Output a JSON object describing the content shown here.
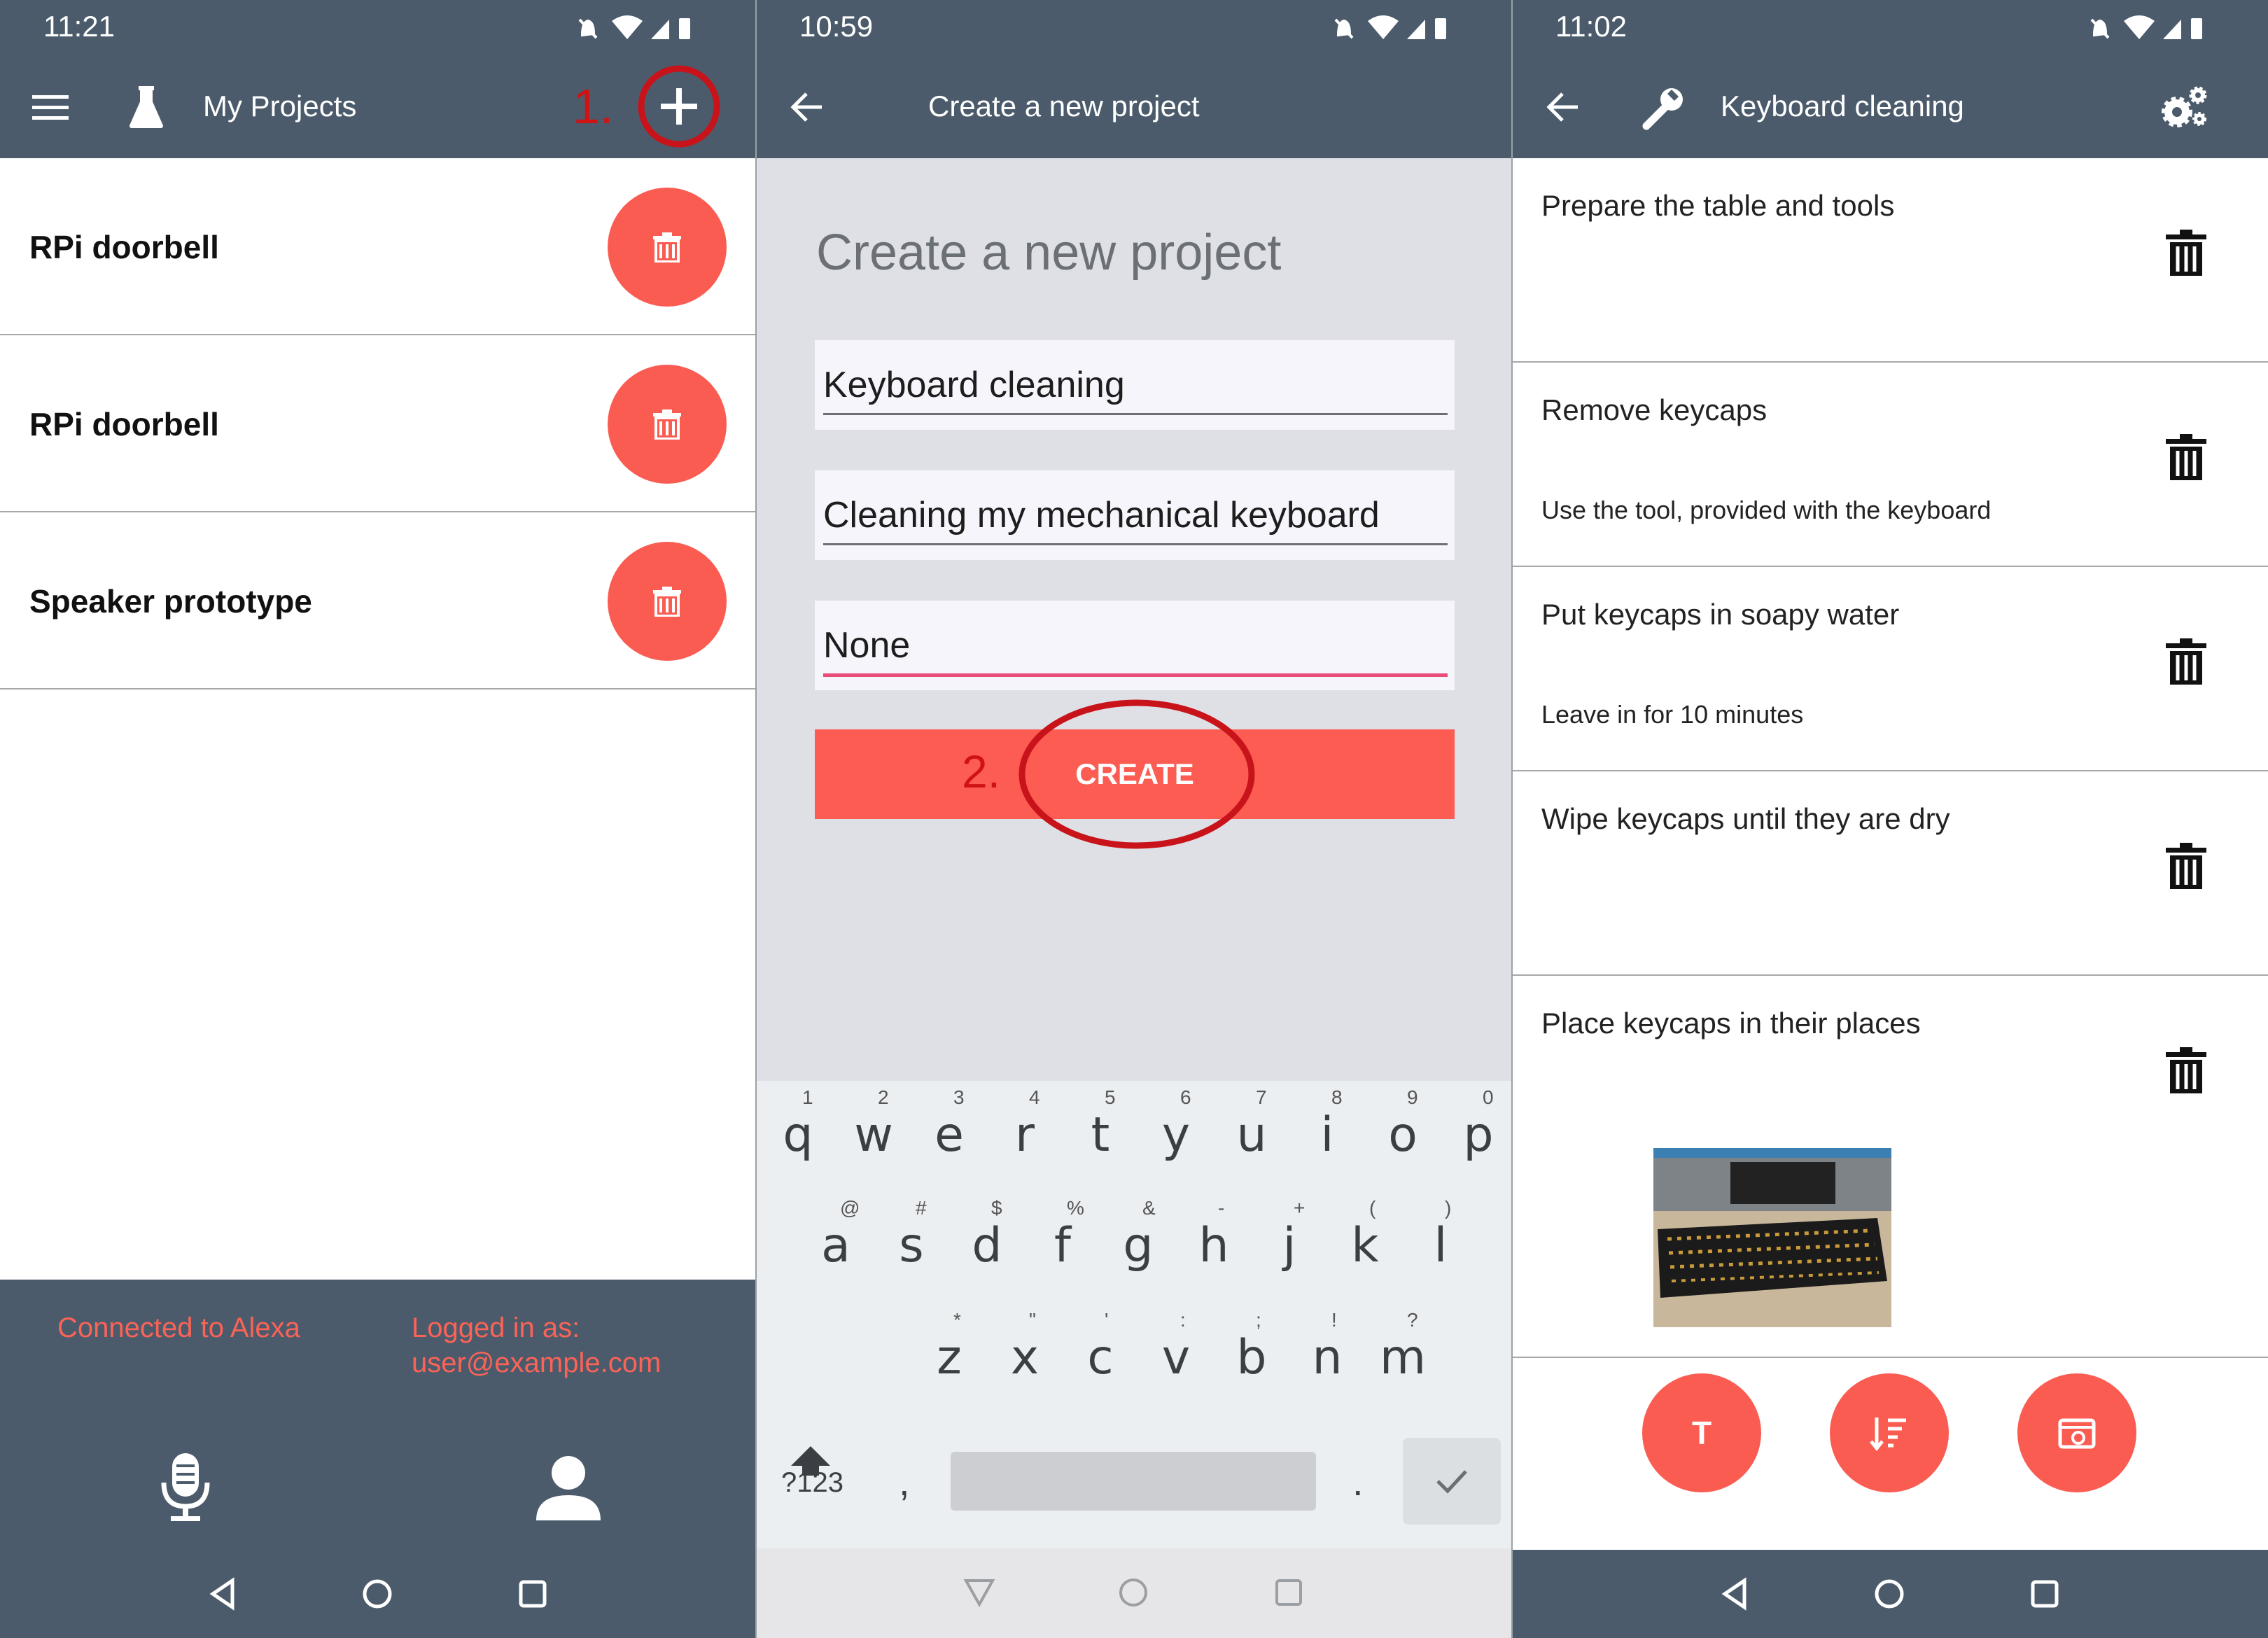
{
  "panel1": {
    "status": {
      "time": "11:21"
    },
    "appbar": {
      "title": "My Projects",
      "annotation": "1."
    },
    "projects": [
      {
        "name": "RPi doorbell"
      },
      {
        "name": "RPi doorbell"
      },
      {
        "name": "Speaker prototype"
      }
    ],
    "footer": {
      "connected": "Connected to Alexa",
      "logged_in_label": "Logged in as:",
      "logged_in_user": "user@example.com"
    }
  },
  "panel2": {
    "status": {
      "time": "10:59"
    },
    "appbar": {
      "title": "Create a new project"
    },
    "form": {
      "heading": "Create a new project",
      "name_value": "Keyboard cleaning",
      "description_value": "Cleaning my mechanical keyboard",
      "third_value": "None",
      "create_label": "CREATE",
      "annotation": "2."
    },
    "keyboard": {
      "row1": [
        [
          "q",
          "1"
        ],
        [
          "w",
          "2"
        ],
        [
          "e",
          "3"
        ],
        [
          "r",
          "4"
        ],
        [
          "t",
          "5"
        ],
        [
          "y",
          "6"
        ],
        [
          "u",
          "7"
        ],
        [
          "i",
          "8"
        ],
        [
          "o",
          "9"
        ],
        [
          "p",
          "0"
        ]
      ],
      "row2": [
        [
          "a",
          "@"
        ],
        [
          "s",
          "#"
        ],
        [
          "d",
          "$"
        ],
        [
          "f",
          "%"
        ],
        [
          "g",
          "&"
        ],
        [
          "h",
          "-"
        ],
        [
          "j",
          "+"
        ],
        [
          "k",
          "("
        ],
        [
          "l",
          ")"
        ]
      ],
      "row3": [
        [
          "z",
          "*"
        ],
        [
          "x",
          "\""
        ],
        [
          "c",
          "'"
        ],
        [
          "v",
          ":"
        ],
        [
          "b",
          ";"
        ],
        [
          "n",
          "!"
        ],
        [
          "m",
          "?"
        ]
      ],
      "symbols_label": "?123",
      "comma": ",",
      "period": "."
    }
  },
  "panel3": {
    "status": {
      "time": "11:02"
    },
    "appbar": {
      "title": "Keyboard cleaning"
    },
    "steps": [
      {
        "title": "Prepare the table and tools",
        "desc": ""
      },
      {
        "title": "Remove keycaps",
        "desc": "Use the tool, provided with the keyboard"
      },
      {
        "title": "Put keycaps in soapy water",
        "desc": "Leave in for 10 minutes"
      },
      {
        "title": "Wipe keycaps until they are dry",
        "desc": ""
      },
      {
        "title": "Place keycaps in their places",
        "desc": ""
      }
    ],
    "fab_labels": {
      "text": "T"
    }
  },
  "colors": {
    "appbar": "#4b5b6b",
    "accent": "#fa5c52",
    "annotation": "#d11212",
    "input_active": "#e84c78"
  },
  "icons": [
    "menu-icon",
    "flask-icon",
    "plus-icon",
    "back-icon",
    "wrench-icon",
    "settings-icon",
    "trash-icon",
    "microphone-icon",
    "user-icon",
    "backspace-icon",
    "shift-icon",
    "check-icon",
    "sort-icon",
    "camera-icon"
  ]
}
